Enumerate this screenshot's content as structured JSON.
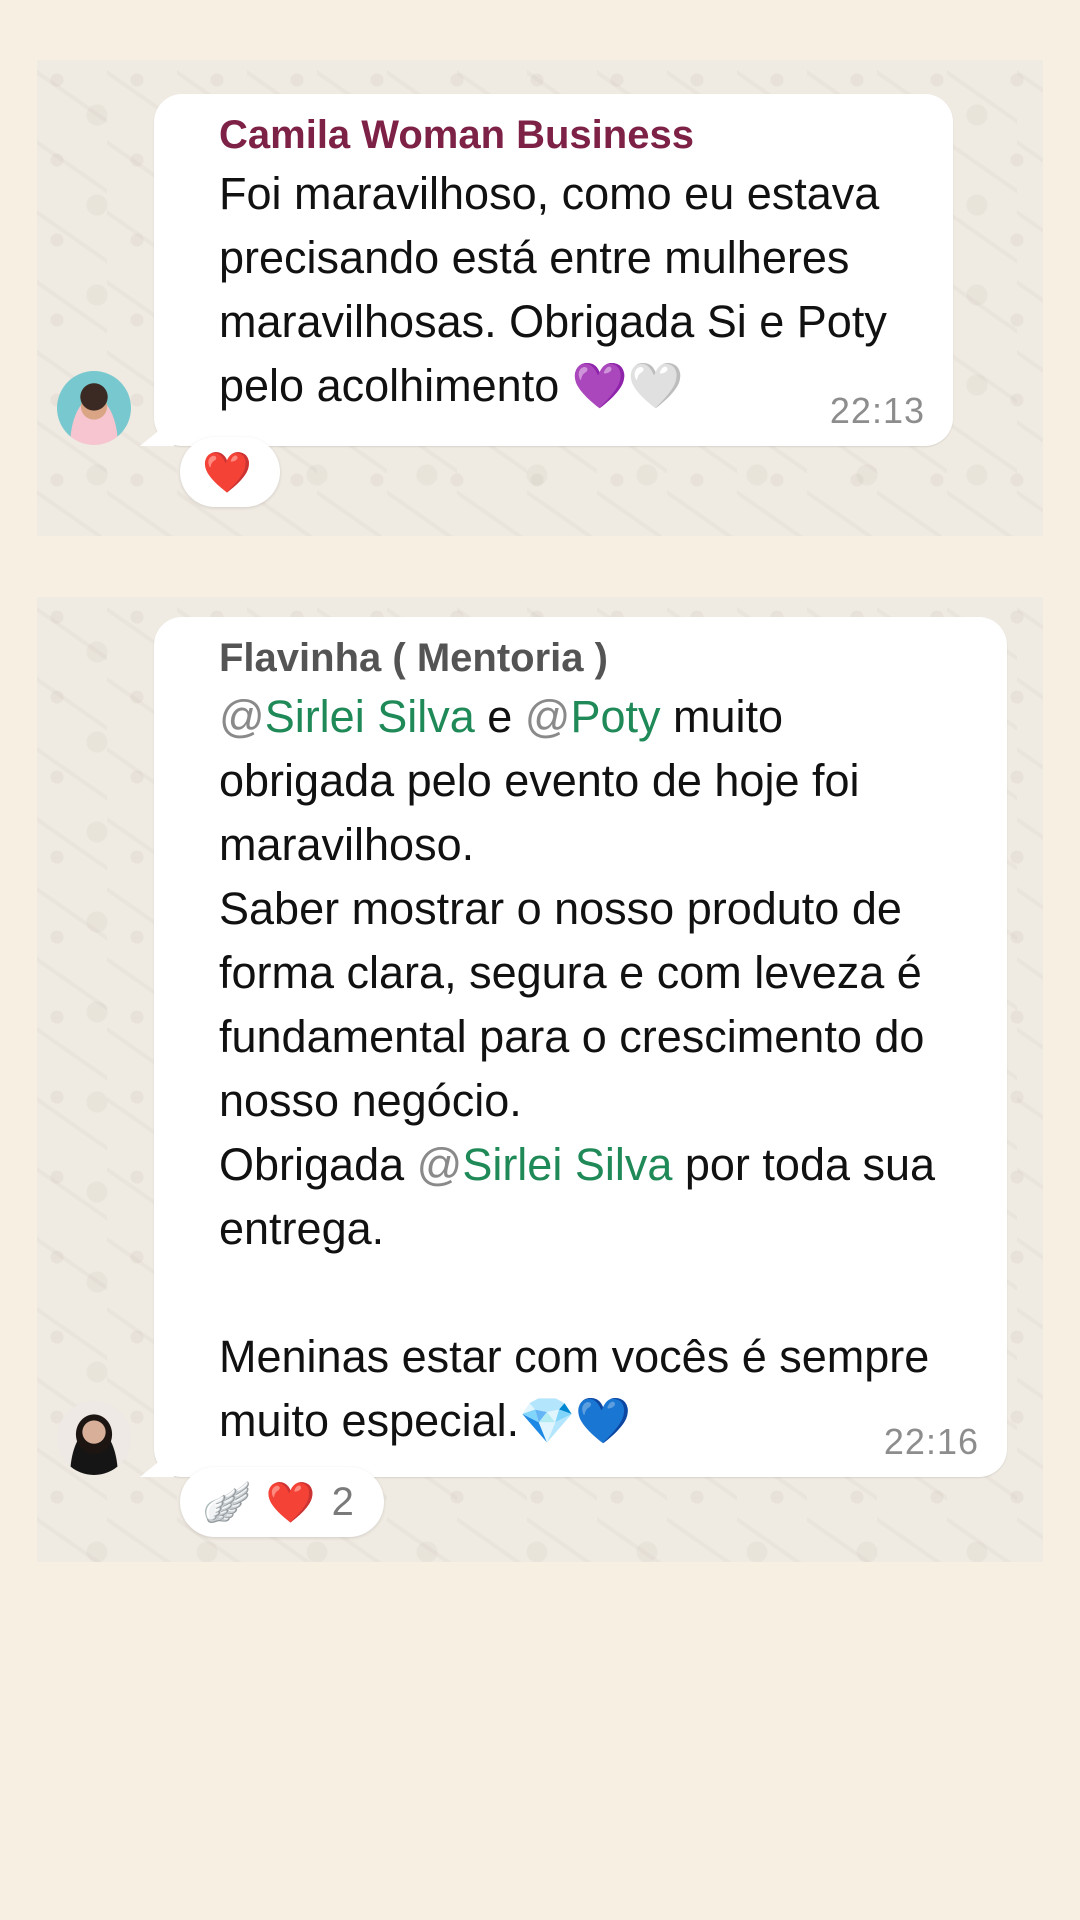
{
  "messages": [
    {
      "sender": "Camila Woman Business",
      "lines": [
        "Foi maravilhoso, como eu estava",
        "precisando está entre mulheres",
        "maravilhosas. Obrigada Si e Poty",
        "pelo acolhimento"
      ],
      "trailing_emojis": "💜🤍",
      "time": "22:13",
      "reactions": [
        "❤️"
      ],
      "reaction_count": ""
    },
    {
      "sender": "Flavinha ( Mentoria )",
      "line1": {
        "at1": "@",
        "mention1": "Sirlei Silva",
        "mid": " e ",
        "at2": "@",
        "mention2": "Poty",
        "tail": " muito"
      },
      "lines_a": [
        "obrigada pelo evento de hoje foi",
        "maravilhoso.",
        "Saber mostrar o nosso produto de",
        "forma clara, segura e com leveza é",
        "fundamental para o crescimento do",
        "nosso negócio."
      ],
      "line_thanks": {
        "head": "Obrigada ",
        "at": "@",
        "mention": "Sirlei Silva",
        "tail": " por toda sua"
      },
      "line_delivery": "entrega.",
      "lines_b": [
        "Meninas estar com vocês é sempre",
        "muito especial."
      ],
      "trailing_emojis": "💎💙",
      "time": "22:16",
      "reactions": [
        "🪽",
        "❤️"
      ],
      "reaction_count": "2"
    }
  ]
}
